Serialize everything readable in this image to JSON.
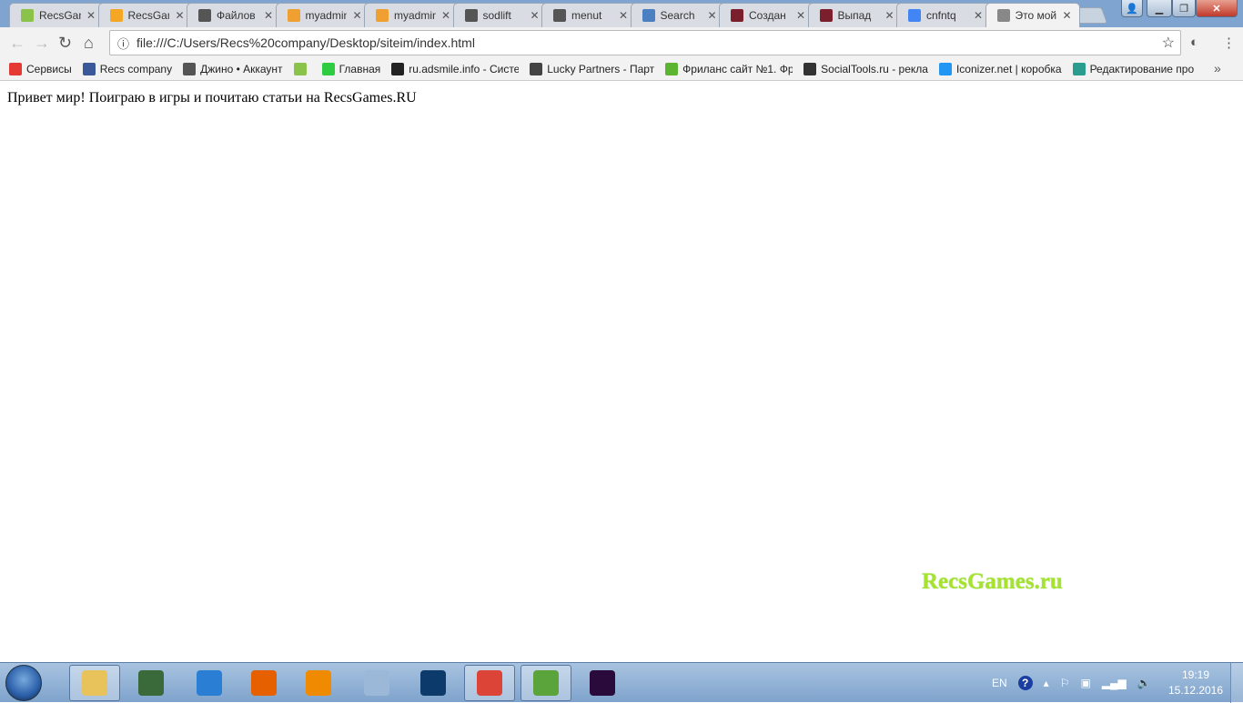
{
  "browser": {
    "tabs": [
      {
        "label": "RecsGames",
        "icon": "gamepad-icon",
        "color": "#8bc34a"
      },
      {
        "label": "RecsGames",
        "icon": "bar-chart-icon",
        "color": "#f5a623"
      },
      {
        "label": "Файлов",
        "icon": "d-icon",
        "color": "#555555"
      },
      {
        "label": "myadmin",
        "icon": "phpmyadmin-icon",
        "color": "#f0a030"
      },
      {
        "label": "myadmin",
        "icon": "phpmyadmin-icon",
        "color": "#f0a030"
      },
      {
        "label": "sodlift",
        "icon": "d-icon",
        "color": "#555555"
      },
      {
        "label": "menut",
        "icon": "d-icon",
        "color": "#555555"
      },
      {
        "label": "Search",
        "icon": "store-icon",
        "color": "#4a7fc1"
      },
      {
        "label": "Создан",
        "icon": "r-icon",
        "color": "#7a1f2b"
      },
      {
        "label": "Выпад",
        "icon": "r-icon",
        "color": "#7a1f2b"
      },
      {
        "label": "cnfntq",
        "icon": "google-icon",
        "color": "#4285f4"
      },
      {
        "label": "Это мой",
        "icon": "page-icon",
        "color": "#888888",
        "active": true
      }
    ],
    "address": "file:///C:/Users/Recs%20company/Desktop/siteim/index.html",
    "bookmarks": [
      {
        "label": "Сервисы",
        "icon": "apps-icon",
        "color": "#e53935"
      },
      {
        "label": "Recs company",
        "icon": "facebook-icon",
        "color": "#3b5998"
      },
      {
        "label": "Джино • Аккаунт",
        "icon": "d-icon",
        "color": "#555555"
      },
      {
        "label": "",
        "icon": "gamepad-icon",
        "color": "#8bc34a"
      },
      {
        "label": "Главная",
        "icon": "w-icon",
        "color": "#2ecc40"
      },
      {
        "label": "ru.adsmile.info - Систе",
        "icon": "as-icon",
        "color": "#222222"
      },
      {
        "label": "Lucky Partners - Парт",
        "icon": "lucky-icon",
        "color": "#444444"
      },
      {
        "label": "Фриланс сайт №1. Фр",
        "icon": "fl-icon",
        "color": "#5cb531"
      },
      {
        "label": "SocialTools.ru - рекла",
        "icon": "socialtools-icon",
        "color": "#333333"
      },
      {
        "label": "Iconizer.net | коробка",
        "icon": "iconizer-icon",
        "color": "#2196f3"
      },
      {
        "label": "Редактирование про",
        "icon": "edit-icon",
        "color": "#2a9d8f"
      }
    ],
    "more": "»"
  },
  "page": {
    "text": "Привет мир! Поиграю в игры и почитаю статьи на RecsGames.RU"
  },
  "watermark": "RecsGames.ru",
  "taskbar": {
    "apps": [
      {
        "name": "explorer",
        "color": "#e8c25a",
        "open": true
      },
      {
        "name": "task-manager",
        "color": "#3a6a3a"
      },
      {
        "name": "internet-explorer",
        "color": "#2a7fd4"
      },
      {
        "name": "firefox",
        "color": "#e66000"
      },
      {
        "name": "media-player",
        "color": "#f08a00"
      },
      {
        "name": "psp",
        "color": "#9bb8d8"
      },
      {
        "name": "photoshop",
        "color": "#0b3a6b"
      },
      {
        "name": "chrome",
        "color": "#db4437",
        "open": true
      },
      {
        "name": "notepad-chart",
        "color": "#5ba33b",
        "open": true
      },
      {
        "name": "premiere",
        "color": "#2a0a3a"
      }
    ],
    "lang": "EN",
    "time": "19:19",
    "date": "15.12.2016"
  }
}
